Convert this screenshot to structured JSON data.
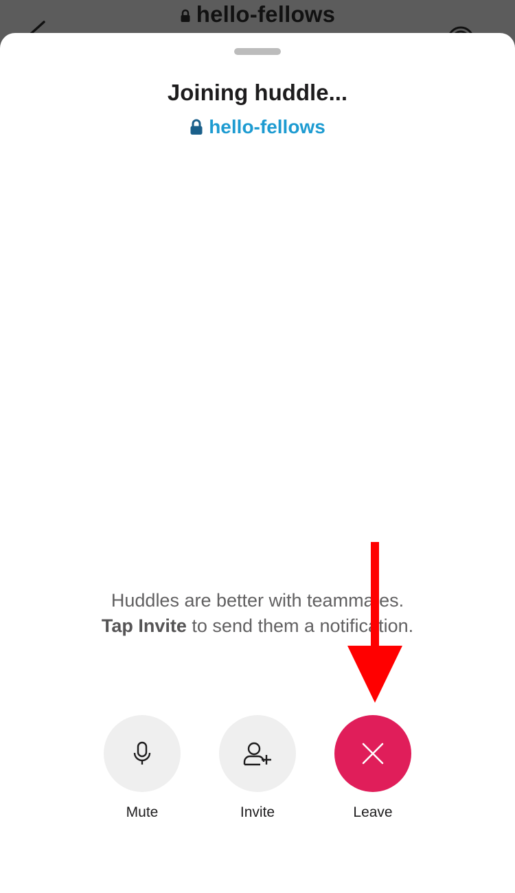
{
  "background": {
    "channel_title": "hello-fellows"
  },
  "sheet": {
    "title": "Joining huddle...",
    "channel_name": "hello-fellows",
    "hint_line1": "Huddles are better with teammates.",
    "hint_bold": "Tap Invite",
    "hint_rest": " to send them a notification."
  },
  "controls": {
    "mute_label": "Mute",
    "invite_label": "Invite",
    "leave_label": "Leave"
  },
  "colors": {
    "leave": "#e01e5a",
    "channel_link": "#1d9bd1",
    "annotation_arrow": "#ff0000"
  },
  "icons": {
    "mute": "microphone-icon",
    "invite": "add-person-icon",
    "leave": "close-icon"
  }
}
